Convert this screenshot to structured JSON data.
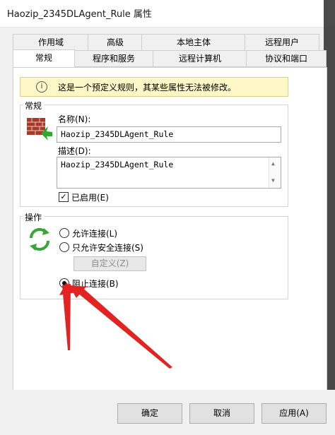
{
  "window": {
    "title": "Haozip_2345DLAgent_Rule 属性"
  },
  "tabs_row1": [
    "作用域",
    "高级",
    "本地主体",
    "远程用户"
  ],
  "tabs_row2": [
    "常规",
    "程序和服务",
    "远程计算机",
    "协议和端口"
  ],
  "active_tab": "常规",
  "info": {
    "icon": "info-icon",
    "message": "这是一个预定义规则，其某些属性无法被修改。"
  },
  "general": {
    "legend": "常规",
    "name_label": "名称(N):",
    "name_value": "Haozip_2345DLAgent_Rule",
    "desc_label": "描述(D):",
    "desc_value": "Haozip_2345DLAgent_Rule",
    "enabled_label": "已启用(E)",
    "enabled": true
  },
  "action": {
    "legend": "操作",
    "allow_label": "允许连接(L)",
    "allow_secure_label": "只允许安全连接(S)",
    "customize_label": "自定义(Z)",
    "block_label": "阻止连接(B)",
    "selected": "block"
  },
  "buttons": {
    "ok": "确定",
    "cancel": "取消",
    "apply": "应用(A)"
  },
  "colors": {
    "annotation_arrow": "#e32222",
    "info_background": "#fdf7c7"
  }
}
